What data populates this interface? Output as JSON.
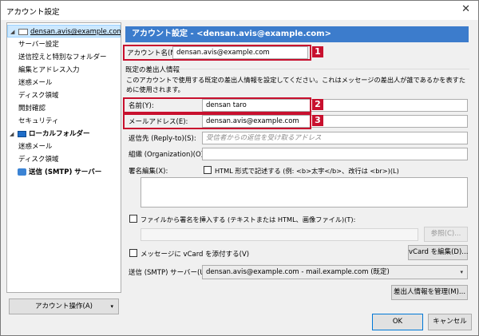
{
  "window": {
    "title": "アカウント設定",
    "close_glyph": "✕"
  },
  "sidebar": {
    "items": [
      {
        "label": "densan.avis@example.com",
        "icon": "mail-account-icon"
      },
      {
        "label": "サーバー設定"
      },
      {
        "label": "送信控えと特別なフォルダー"
      },
      {
        "label": "編集とアドレス入力"
      },
      {
        "label": "迷惑メール"
      },
      {
        "label": "ディスク領域"
      },
      {
        "label": "開封確認"
      },
      {
        "label": "セキュリティ"
      },
      {
        "label": "ローカルフォルダー",
        "icon": "local-folder-icon"
      },
      {
        "label": "迷惑メール"
      },
      {
        "label": "ディスク領域"
      },
      {
        "label": "送信 (SMTP) サーバー",
        "icon": "outgoing-server-icon"
      }
    ],
    "account_ops_label": "アカウント操作(A)",
    "dropdown_glyph": "▾"
  },
  "main": {
    "header": "アカウント設定 - <densan.avis@example.com>",
    "account_name_label": "アカウント名(N):",
    "account_name_value": "densan.avis@example.com",
    "identity_group_label": "既定の差出人情報",
    "identity_description": "このアカウントで使用する既定の差出人情報を設定してください。これはメッセージの差出人が誰であるかを表すために使用されます。",
    "name_label": "名前(Y):",
    "name_value": "densan taro",
    "email_label": "メールアドレス(E):",
    "email_value": "densan.avis@example.com",
    "reply_to_label": "返信先 (Reply-to)(S):",
    "reply_to_placeholder": "受信者からの返信を受け取るアドレス",
    "org_label": "組織 (Organization)(O):",
    "org_value": "",
    "signature_label": "署名編集(X):",
    "html_checkbox_label": "HTML 形式で記述する (例: <b>太字</b>、改行は <br>)(L)",
    "file_signature_label": "ファイルから署名を挿入する (テキストまたは HTML、画像ファイル)(T):",
    "browse_label": "参照(C)...",
    "vcard_checkbox_label": "メッセージに vCard を添付する(V)",
    "vcard_edit_label": "vCard を編集(D)...",
    "smtp_label": "送信 (SMTP) サーバー(U):",
    "smtp_value": "densan.avis@example.com - mail.example.com (既定)",
    "manage_identities_label": "差出人情報を管理(M)..."
  },
  "badges": [
    "1",
    "2",
    "3"
  ],
  "buttons": {
    "ok": "OK",
    "cancel": "キャンセル"
  },
  "colors": {
    "header_blue": "#3c7ccc",
    "highlight_red": "#c8102e",
    "selection": "#cce8ff"
  }
}
